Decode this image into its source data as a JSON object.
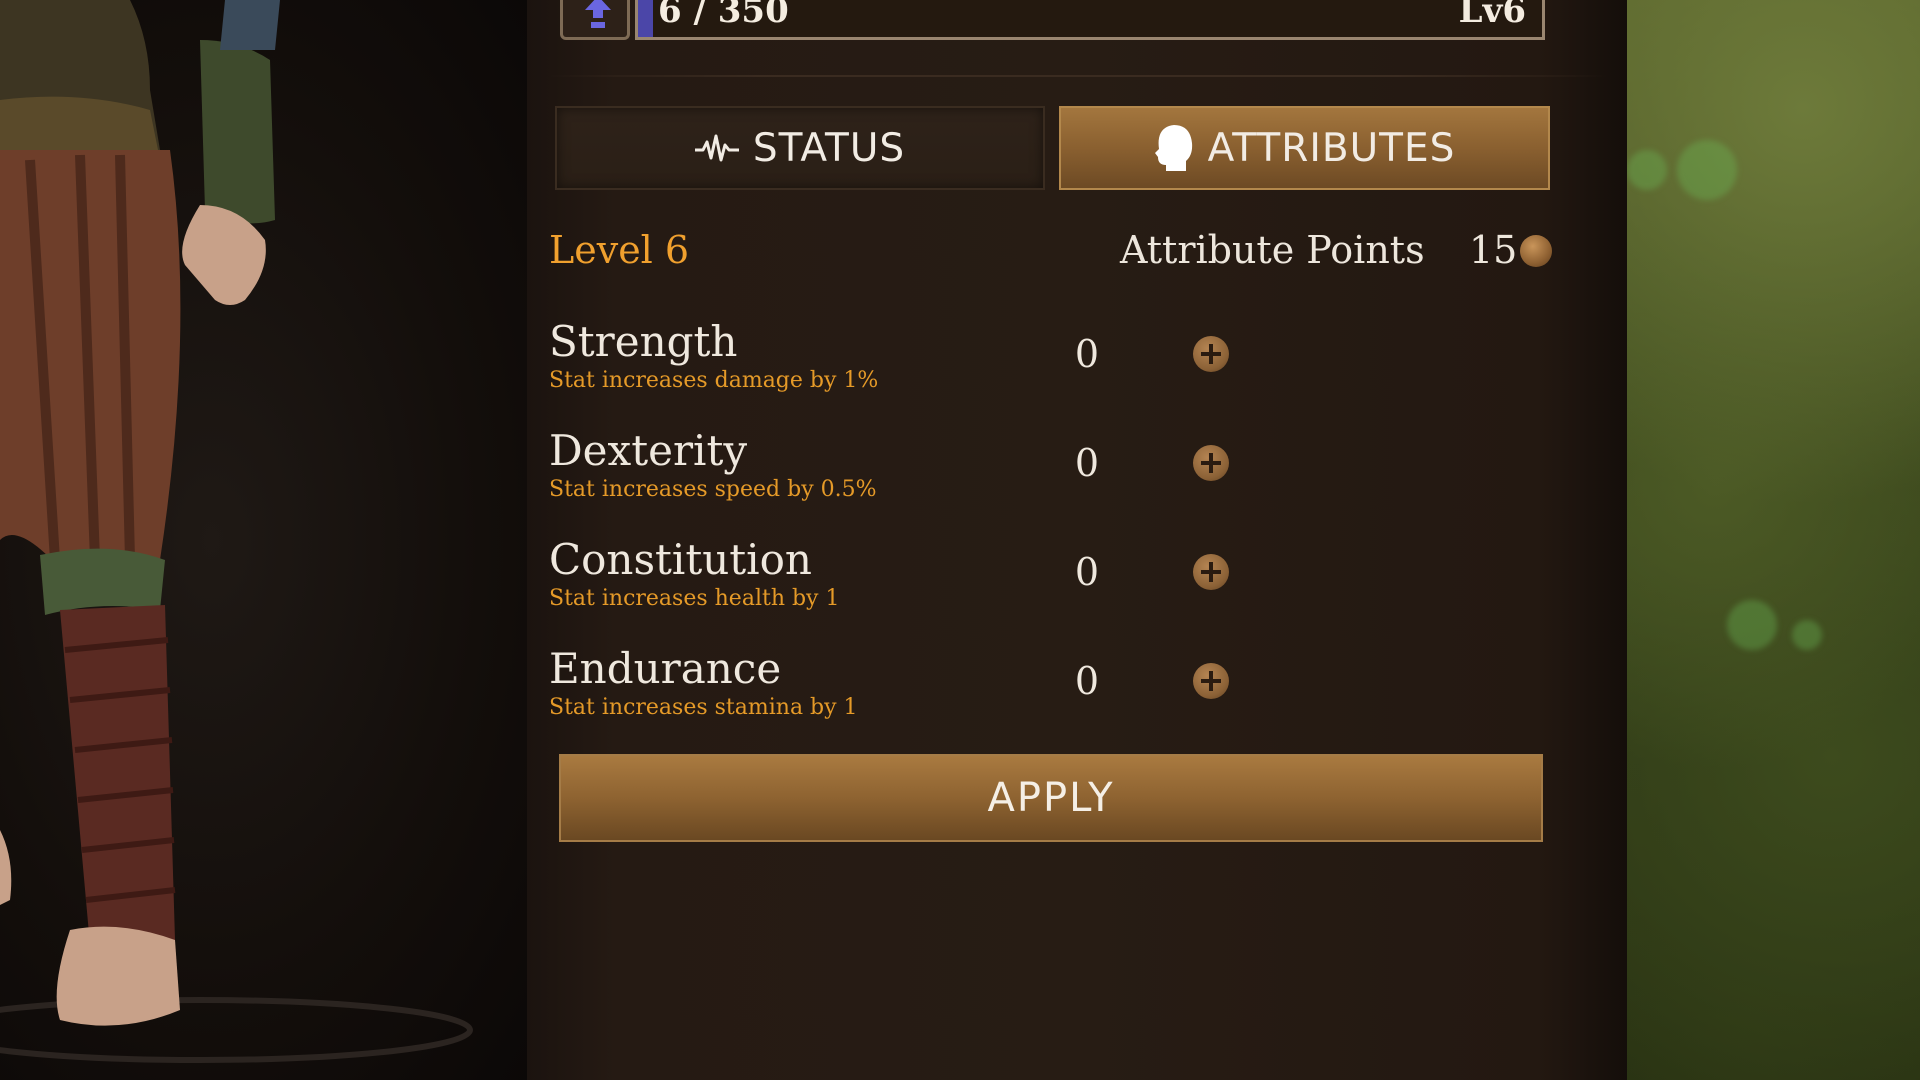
{
  "xp": {
    "text": "6 / 350",
    "level_badge": "Lv6",
    "progress": 0.017,
    "icon": "level-up-arrow-icon"
  },
  "tabs": [
    {
      "label": "STATUS",
      "icon": "pulse-icon",
      "active": false
    },
    {
      "label": "ATTRIBUTES",
      "icon": "head-profile-icon",
      "active": true
    }
  ],
  "level": {
    "label": "Level 6"
  },
  "attribute_points": {
    "label": "Attribute Points",
    "value": "15",
    "icon": "coin-icon"
  },
  "attributes": [
    {
      "name": "Strength",
      "description": "Stat increases damage by 1%",
      "value": "0"
    },
    {
      "name": "Dexterity",
      "description": "Stat increases speed by 0.5%",
      "value": "0"
    },
    {
      "name": "Constitution",
      "description": "Stat increases health by 1",
      "value": "0"
    },
    {
      "name": "Endurance",
      "description": "Stat increases stamina by 1",
      "value": "0"
    }
  ],
  "apply": {
    "label": "APPLY"
  },
  "colors": {
    "accent_orange": "#f0a02e",
    "button_gold": "#8e6331",
    "xp_fill": "#4b46a8",
    "panel_bg": "#271c14"
  }
}
